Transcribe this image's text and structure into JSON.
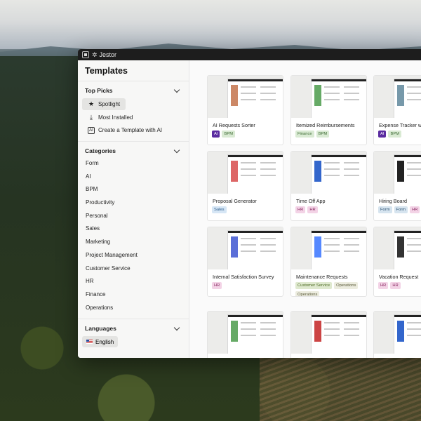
{
  "window": {
    "app_name": "Jestor"
  },
  "sidebar": {
    "title": "Templates",
    "top_picks": {
      "heading": "Top Picks",
      "items": [
        {
          "label": "Spotlight",
          "icon": "star-icon"
        },
        {
          "label": "Most Installed",
          "icon": "download-icon"
        },
        {
          "label": "Create a Template with AI",
          "icon": "ai-icon"
        }
      ]
    },
    "categories": {
      "heading": "Categories",
      "items": [
        "Form",
        "AI",
        "BPM",
        "Productivity",
        "Personal",
        "Sales",
        "Marketing",
        "Project Management",
        "Customer Service",
        "HR",
        "Finance",
        "Operations"
      ]
    },
    "languages": {
      "heading": "Languages",
      "selected": "English"
    }
  },
  "cards": [
    {
      "name": "AI Requests Sorter",
      "tags": [
        {
          "label": "AI",
          "kind": "ai"
        },
        {
          "label": "BPM",
          "kind": "bpm"
        }
      ]
    },
    {
      "name": "Itemized Reimbursements",
      "tags": [
        {
          "label": "Finance",
          "kind": "finance"
        },
        {
          "label": "BPM",
          "kind": "bpm"
        }
      ]
    },
    {
      "name": "Expense Tracker w",
      "tags": [
        {
          "label": "AI",
          "kind": "ai"
        },
        {
          "label": "BPM",
          "kind": "bpm"
        }
      ]
    },
    {
      "name": "Proposal Generator",
      "tags": [
        {
          "label": "Sales",
          "kind": "sales"
        }
      ]
    },
    {
      "name": "Time Off App",
      "tags": [
        {
          "label": "HR",
          "kind": "hr"
        },
        {
          "label": "HR",
          "kind": "hr"
        }
      ]
    },
    {
      "name": "Hiring Board",
      "tags": [
        {
          "label": "Form",
          "kind": "form"
        },
        {
          "label": "Form",
          "kind": "form"
        },
        {
          "label": "HR",
          "kind": "hr"
        }
      ]
    },
    {
      "name": "Internal Satisfaction Survey",
      "tags": [
        {
          "label": "HR",
          "kind": "hr"
        }
      ]
    },
    {
      "name": "Maintenance Requests",
      "tags": [
        {
          "label": "Customer Service",
          "kind": "cs"
        },
        {
          "label": "Operations",
          "kind": "ops"
        },
        {
          "label": "Operations",
          "kind": "ops"
        }
      ]
    },
    {
      "name": "Vacation Request",
      "tags": [
        {
          "label": "HR",
          "kind": "hr"
        },
        {
          "label": "HR",
          "kind": "hr"
        }
      ]
    },
    {
      "name": "",
      "tags": []
    },
    {
      "name": "",
      "tags": []
    },
    {
      "name": "",
      "tags": []
    }
  ]
}
